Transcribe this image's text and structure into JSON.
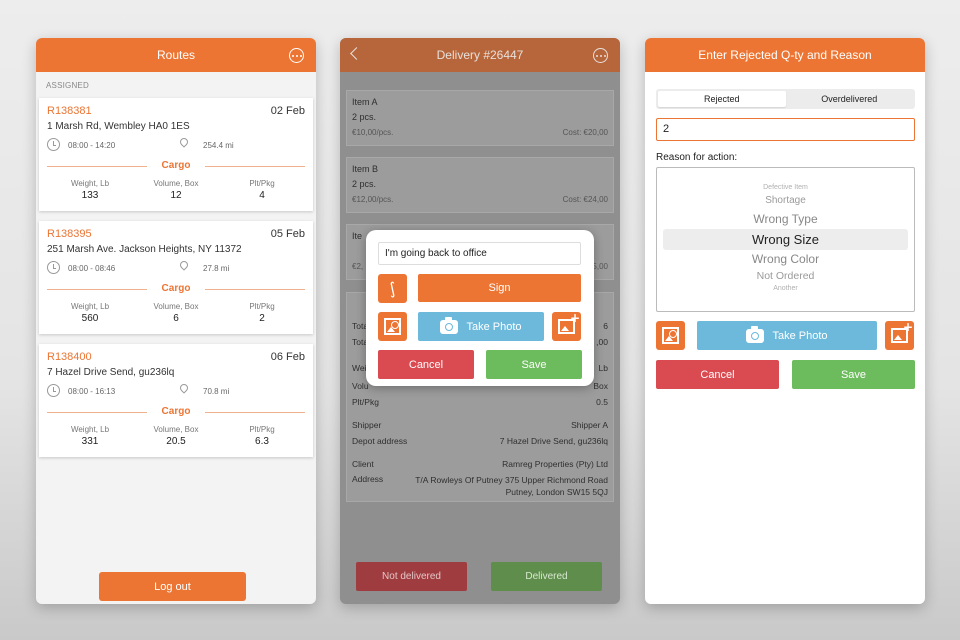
{
  "colors": {
    "accent": "#ec7533",
    "cancel": "#d94a51",
    "save": "#6cbb5c",
    "photo": "#6cb9dc"
  },
  "routes_screen": {
    "title": "Routes",
    "section_label": "ASSIGNED",
    "cargo_label": "Cargo",
    "metric_headers": [
      "Weight, Lb",
      "Volume, Box",
      "Plt/Pkg"
    ],
    "routes": [
      {
        "code": "R138381",
        "date": "02 Feb",
        "address": "1 Marsh Rd, Wembley HA0 1ES",
        "time": "08:00 - 14:20",
        "distance": "254.4 mi",
        "weight": "133",
        "volume": "12",
        "plt": "4"
      },
      {
        "code": "R138395",
        "date": "05 Feb",
        "address": "251 Marsh Ave. Jackson Heights, NY 11372",
        "time": "08:00 - 08:46",
        "distance": "27.8 mi",
        "weight": "560",
        "volume": "6",
        "plt": "2"
      },
      {
        "code": "R138400",
        "date": "06 Feb",
        "address": "7 Hazel Drive Send, gu236lq",
        "time": "08:00 - 16:13",
        "distance": "70.8 mi",
        "weight": "331",
        "volume": "20.5",
        "plt": "6.3"
      }
    ],
    "logout_label": "Log out"
  },
  "delivery_screen": {
    "title": "Delivery #26447",
    "items": [
      {
        "name": "Item A",
        "qty": "2 pcs.",
        "price": "€10,00/pcs.",
        "cost": "Cost: €20,00"
      },
      {
        "name": "Item B",
        "qty": "2 pcs.",
        "price": "€12,00/pcs.",
        "cost": "Cost: €24,00"
      },
      {
        "name": "Ite",
        "qty": "",
        "price": "€2,",
        "cost": "5,00"
      }
    ],
    "details": {
      "tot1_label": "Tota",
      "tot1_value": "6",
      "tot2_label": "Tota",
      "tot2_value": ",00",
      "wei_label": "Wei",
      "wei_value": "Lb",
      "vol_label": "Volu",
      "vol_value": "Box",
      "plt_label": "Plt/Pkg",
      "plt_value": "0.5",
      "shipper_label": "Shipper",
      "shipper_value": "Shipper A",
      "depot_label": "Depot address",
      "depot_value": "7 Hazel Drive Send, gu236lq",
      "client_label": "Client",
      "client_value": "Ramreg Properties (Pty) Ltd",
      "address_label": "Address",
      "address_value": "T/A Rowleys Of Putney 375 Upper Richmond Road Putney, London SW15 5QJ"
    },
    "not_delivered_label": "Not delivered",
    "delivered_label": "Delivered",
    "modal": {
      "input_value": "I'm going back to office",
      "sign_label": "Sign",
      "take_photo_label": "Take Photo",
      "cancel_label": "Cancel",
      "save_label": "Save"
    }
  },
  "rejected_screen": {
    "title": "Enter Rejected Q-ty and Reason",
    "tabs": [
      "Rejected",
      "Overdelivered"
    ],
    "quantity_value": "2",
    "reason_label": "Reason for action:",
    "reason_options": [
      "Defective Item",
      "Shortage",
      "Wrong Type",
      "Wrong Size",
      "Wrong Color",
      "Not Ordered",
      "Another"
    ],
    "selected_reason": "Wrong Size",
    "take_photo_label": "Take Photo",
    "cancel_label": "Cancel",
    "save_label": "Save"
  }
}
